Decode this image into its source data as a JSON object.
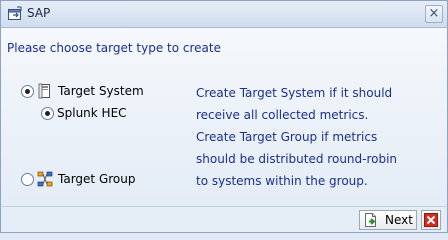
{
  "window": {
    "title": "SAP",
    "close_glyph": "×"
  },
  "prompt": "Please choose target type to create",
  "options": [
    {
      "label": "Target System",
      "selected": true,
      "icon": "target-system-icon"
    },
    {
      "label": "Splunk HEC",
      "selected": true,
      "icon": ""
    },
    {
      "label": "Target Group",
      "selected": false,
      "icon": "target-group-icon"
    }
  ],
  "description_lines": [
    "Create Target System if it should",
    "receive all collected metrics.",
    "Create Target Group if metrics",
    "should be distributed round-robin",
    "to systems within the group."
  ],
  "footer": {
    "next_label": "Next"
  },
  "colors": {
    "accent_text": "#1b2f8c",
    "cancel_red": "#d62b1f"
  }
}
